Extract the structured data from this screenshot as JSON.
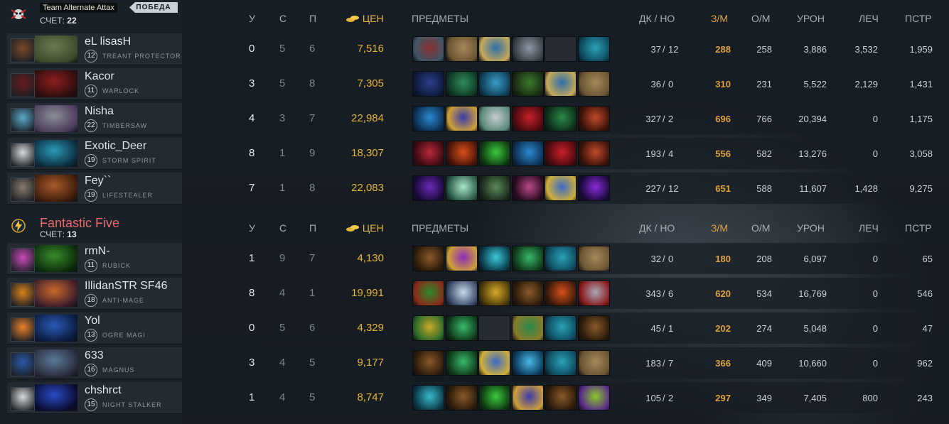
{
  "header": {
    "cols": {
      "k": "У",
      "d": "С",
      "a": "П",
      "gold": "ЦЕН",
      "items": "ПРЕДМЕТЫ",
      "lh": "ДК",
      "sep": "/",
      "dn": "НО",
      "gpm": "З/М",
      "xpm": "О/М",
      "dmg": "УРОН",
      "heal": "ЛЕЧ",
      "bld": "ПСТР"
    }
  },
  "teams": [
    {
      "name": "Team Alternate Attax",
      "badge": "ПОБЕДА",
      "score_label": "СЧЕТ:",
      "score": "22",
      "logo_icon": "spider-skull-logo-icon",
      "players": [
        {
          "name": "eL lisasH",
          "level": "12",
          "hero": "TREANT PROTECTOR",
          "k": "0",
          "d": "5",
          "a": "6",
          "nw": "7,516",
          "lh": "37",
          "dn": "12",
          "gpm": "288",
          "xpm": "258",
          "dmg": "3,886",
          "heal": "3,532",
          "bld": "1,959",
          "avatar_color": "#7a4a2a",
          "hero_colors": [
            "#6d7a52",
            "#3b4a2a"
          ],
          "items": [
            [
              "#8a2f2f",
              "#3f5668"
            ],
            [
              "#a48a5a",
              "#6b5432"
            ],
            [
              "#2c6ea8",
              "#c6a95a"
            ],
            [
              "#8c98a4",
              "#3a3f46"
            ],
            null,
            [
              "#2aa2b8",
              "#0e4a5e"
            ]
          ]
        },
        {
          "name": "Kacor",
          "level": "11",
          "hero": "WARLOCK",
          "k": "3",
          "d": "5",
          "a": "8",
          "nw": "7,305",
          "lh": "36",
          "dn": "0",
          "gpm": "310",
          "xpm": "231",
          "dmg": "5,522",
          "heal": "2,129",
          "bld": "1,431",
          "avatar_color": "#6a1c1c",
          "hero_colors": [
            "#8c1e1e",
            "#2a0d0d"
          ],
          "items": [
            [
              "#2a3f8a",
              "#0f1a3c"
            ],
            [
              "#2f8a5a",
              "#0e3a24"
            ],
            [
              "#3a9ec8",
              "#0f3e56"
            ],
            [
              "#3a7a2a",
              "#1a2a12"
            ],
            [
              "#2c6ea8",
              "#c6a95a"
            ],
            [
              "#a48a5a",
              "#6b5432"
            ]
          ]
        },
        {
          "name": "Nisha",
          "level": "22",
          "hero": "TIMBERSAW",
          "k": "4",
          "d": "3",
          "a": "7",
          "nw": "22,984",
          "lh": "327",
          "dn": "2",
          "gpm": "696",
          "xpm": "766",
          "dmg": "20,394",
          "heal": "0",
          "bld": "1,175",
          "avatar_color": "#5aa8c8",
          "hero_colors": [
            "#8a8e96",
            "#4a3a5a"
          ],
          "items": [
            [
              "#2a8ad0",
              "#0d2f52"
            ],
            [
              "#3a3aa8",
              "#d0a03a"
            ],
            [
              "#c8ccd0",
              "#5a8a7a"
            ],
            [
              "#c8202a",
              "#4a0a0e"
            ],
            [
              "#2a8a4a",
              "#0e2f1a"
            ],
            [
              "#c04a2a",
              "#3a1208"
            ]
          ]
        },
        {
          "name": "Exotic_Deer",
          "level": "19",
          "hero": "STORM SPIRIT",
          "k": "8",
          "d": "1",
          "a": "9",
          "nw": "18,307",
          "lh": "193",
          "dn": "4",
          "gpm": "556",
          "xpm": "582",
          "dmg": "13,276",
          "heal": "0",
          "bld": "3,058",
          "avatar_color": "#d8d8d8",
          "hero_colors": [
            "#2a9ab8",
            "#0a2a3a"
          ],
          "items": [
            [
              "#b82a3a",
              "#3a0a10"
            ],
            [
              "#d8501a",
              "#4a1408"
            ],
            [
              "#3ac83a",
              "#0e3a12"
            ],
            [
              "#2a8ad0",
              "#0d2f52"
            ],
            [
              "#c8202a",
              "#4a0a0e"
            ],
            [
              "#c04a2a",
              "#3a1208"
            ]
          ]
        },
        {
          "name": "Fey``",
          "level": "19",
          "hero": "LIFESTEALER",
          "k": "7",
          "d": "1",
          "a": "8",
          "nw": "22,083",
          "lh": "227",
          "dn": "12",
          "gpm": "651",
          "xpm": "588",
          "dmg": "11,607",
          "heal": "1,428",
          "bld": "9,275",
          "avatar_color": "#8a7a6a",
          "hero_colors": [
            "#a85a2a",
            "#3a1a0a"
          ],
          "items": [
            [
              "#6a2ab8",
              "#1a0a3a"
            ],
            [
              "#a8e8c8",
              "#2a5a4a"
            ],
            [
              "#5a8a5a",
              "#1a2a1a"
            ],
            [
              "#b84a8a",
              "#2a0a1e"
            ],
            [
              "#3a6ac8",
              "#d0b03a"
            ],
            [
              "#8a2ad8",
              "#1a0a3a"
            ]
          ]
        }
      ]
    },
    {
      "name": "Fantastic Five",
      "score_label": "СЧЕТ:",
      "score": "13",
      "logo_icon": "lightning-bolt-logo-icon",
      "players": [
        {
          "name": "rmN-",
          "level": "11",
          "hero": "RUBICK",
          "k": "1",
          "d": "9",
          "a": "7",
          "nw": "4,130",
          "lh": "32",
          "dn": "0",
          "gpm": "180",
          "xpm": "208",
          "dmg": "6,097",
          "heal": "0",
          "bld": "65",
          "avatar_color": "#c84ab8",
          "hero_colors": [
            "#3a8a2a",
            "#0a2a0a"
          ],
          "items": [
            [
              "#8a5a2a",
              "#2a1a0a"
            ],
            [
              "#8a2ab8",
              "#d0a03a"
            ],
            [
              "#3ac8d8",
              "#0a3a4a"
            ],
            [
              "#3ab86a",
              "#0e3a1a"
            ],
            [
              "#2aa2b8",
              "#0e4a5e"
            ],
            [
              "#a48a5a",
              "#6b5432"
            ]
          ]
        },
        {
          "name": "IllidanSTR SF46",
          "level": "18",
          "hero": "ANTI-MAGE",
          "k": "8",
          "d": "4",
          "a": "1",
          "nw": "19,991",
          "lh": "343",
          "dn": "6",
          "gpm": "620",
          "xpm": "534",
          "dmg": "16,769",
          "heal": "0",
          "bld": "546",
          "avatar_color": "#d8801a",
          "hero_colors": [
            "#c86a2a",
            "#3a1a2a"
          ],
          "items": [
            [
              "#2a8a2a",
              "#8a2a1a"
            ],
            [
              "#c8d8e8",
              "#3a4a6a"
            ],
            [
              "#d8a82a",
              "#4a3a0a"
            ],
            [
              "#8a5a2a",
              "#2a1a0a"
            ],
            [
              "#d8501a",
              "#3a1a0a"
            ],
            [
              "#a8a8b8",
              "#8a1a1a"
            ]
          ]
        },
        {
          "name": "Yol",
          "level": "13",
          "hero": "OGRE MAGI",
          "k": "0",
          "d": "5",
          "a": "6",
          "nw": "4,329",
          "lh": "45",
          "dn": "1",
          "gpm": "202",
          "xpm": "274",
          "dmg": "5,048",
          "heal": "0",
          "bld": "47",
          "avatar_color": "#e8802a",
          "hero_colors": [
            "#2a5ab8",
            "#0a1a3a"
          ],
          "items": [
            [
              "#c8a82a",
              "#2a6a2a"
            ],
            [
              "#3ab86a",
              "#0e3a1a"
            ],
            null,
            [
              "#2a8a4a",
              "#8a7a2a"
            ],
            [
              "#2aa2b8",
              "#0e4a5e"
            ],
            [
              "#8a5a2a",
              "#2a1a0a"
            ]
          ]
        },
        {
          "name": "633",
          "level": "16",
          "hero": "MAGNUS",
          "k": "3",
          "d": "4",
          "a": "5",
          "nw": "9,177",
          "lh": "183",
          "dn": "7",
          "gpm": "366",
          "xpm": "409",
          "dmg": "10,660",
          "heal": "0",
          "bld": "962",
          "avatar_color": "#2a5aa8",
          "hero_colors": [
            "#5a7a9a",
            "#2a2a3a"
          ],
          "items": [
            [
              "#8a5a2a",
              "#2a1a0a"
            ],
            [
              "#3ab86a",
              "#0e3a1a"
            ],
            [
              "#3a6ac8",
              "#d0b03a"
            ],
            [
              "#4ab8e8",
              "#0a3a5a"
            ],
            [
              "#2aa2b8",
              "#0e4a5e"
            ],
            [
              "#a48a5a",
              "#6b5432"
            ]
          ]
        },
        {
          "name": "chshrct",
          "level": "15",
          "hero": "NIGHT STALKER",
          "k": "1",
          "d": "4",
          "a": "5",
          "nw": "8,747",
          "lh": "105",
          "dn": "2",
          "gpm": "297",
          "xpm": "349",
          "dmg": "7,405",
          "heal": "800",
          "bld": "243",
          "avatar_color": "#d8d8d8",
          "hero_colors": [
            "#2a4ac8",
            "#0a0a2a"
          ],
          "items": [
            [
              "#3ab8c8",
              "#0a3a4a"
            ],
            [
              "#8a5a2a",
              "#2a1a0a"
            ],
            [
              "#3ac83a",
              "#0e3a12"
            ],
            [
              "#3a3aa8",
              "#d0a03a"
            ],
            [
              "#8a5a2a",
              "#2a1a0a"
            ],
            [
              "#8ac82a",
              "#5a2a8a"
            ]
          ]
        }
      ]
    }
  ]
}
